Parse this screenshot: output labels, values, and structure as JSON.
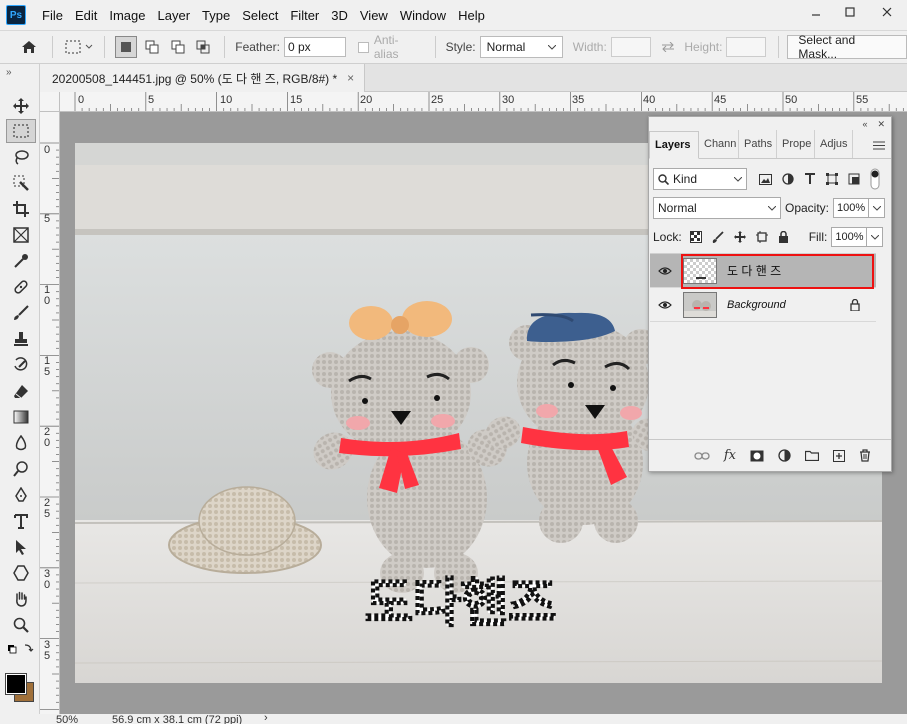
{
  "menubar": {
    "logo": "Ps",
    "items": [
      "File",
      "Edit",
      "Image",
      "Layer",
      "Type",
      "Select",
      "Filter",
      "3D",
      "View",
      "Window",
      "Help"
    ],
    "window_controls": [
      "minimize",
      "maximize",
      "close"
    ]
  },
  "options": {
    "feather_label": "Feather:",
    "feather_value": "0 px",
    "antialias_label": "Anti-alias",
    "style_label": "Style:",
    "style_value": "Normal",
    "width_label": "Width:",
    "height_label": "Height:",
    "select_mask": "Select and Mask..."
  },
  "document": {
    "tab_title": "20200508_144451.jpg @ 50% (도 다 핸 즈, RGB/8#) *",
    "close": "×"
  },
  "ruler": {
    "h_ticks": [
      "0",
      "5",
      "10",
      "15",
      "20",
      "25",
      "30",
      "35",
      "40",
      "45",
      "50",
      "55"
    ],
    "v_ticks": [
      "0",
      "5",
      "10",
      "15",
      "20",
      "25",
      "30",
      "35"
    ]
  },
  "canvas": {
    "overlay_text": "도다핸즈"
  },
  "status": {
    "zoom": "50%",
    "doc_size": "56.9 cm x 38.1 cm (72 ppi)"
  },
  "layers_panel": {
    "tabs": [
      "Layers",
      "Chann",
      "Paths",
      "Prope",
      "Adjus"
    ],
    "filter_kind": "Kind",
    "blend_mode": "Normal",
    "opacity_label": "Opacity:",
    "opacity_value": "100%",
    "lock_label": "Lock:",
    "fill_label": "Fill:",
    "fill_value": "100%",
    "layers": [
      {
        "name": "도 다 핸 즈",
        "selected": true,
        "visible": true
      },
      {
        "name": "Background",
        "selected": false,
        "visible": true,
        "locked": true
      }
    ],
    "footer_icons": [
      "link-icon",
      "fx-icon",
      "mask-icon",
      "adjustment-icon",
      "folder-icon",
      "new-layer-icon",
      "trash-icon"
    ]
  },
  "colors": {
    "accent_selection": "#e11111",
    "ps_brand": "#31a8ff",
    "foreground": "#000000",
    "background": "#a0703a"
  }
}
